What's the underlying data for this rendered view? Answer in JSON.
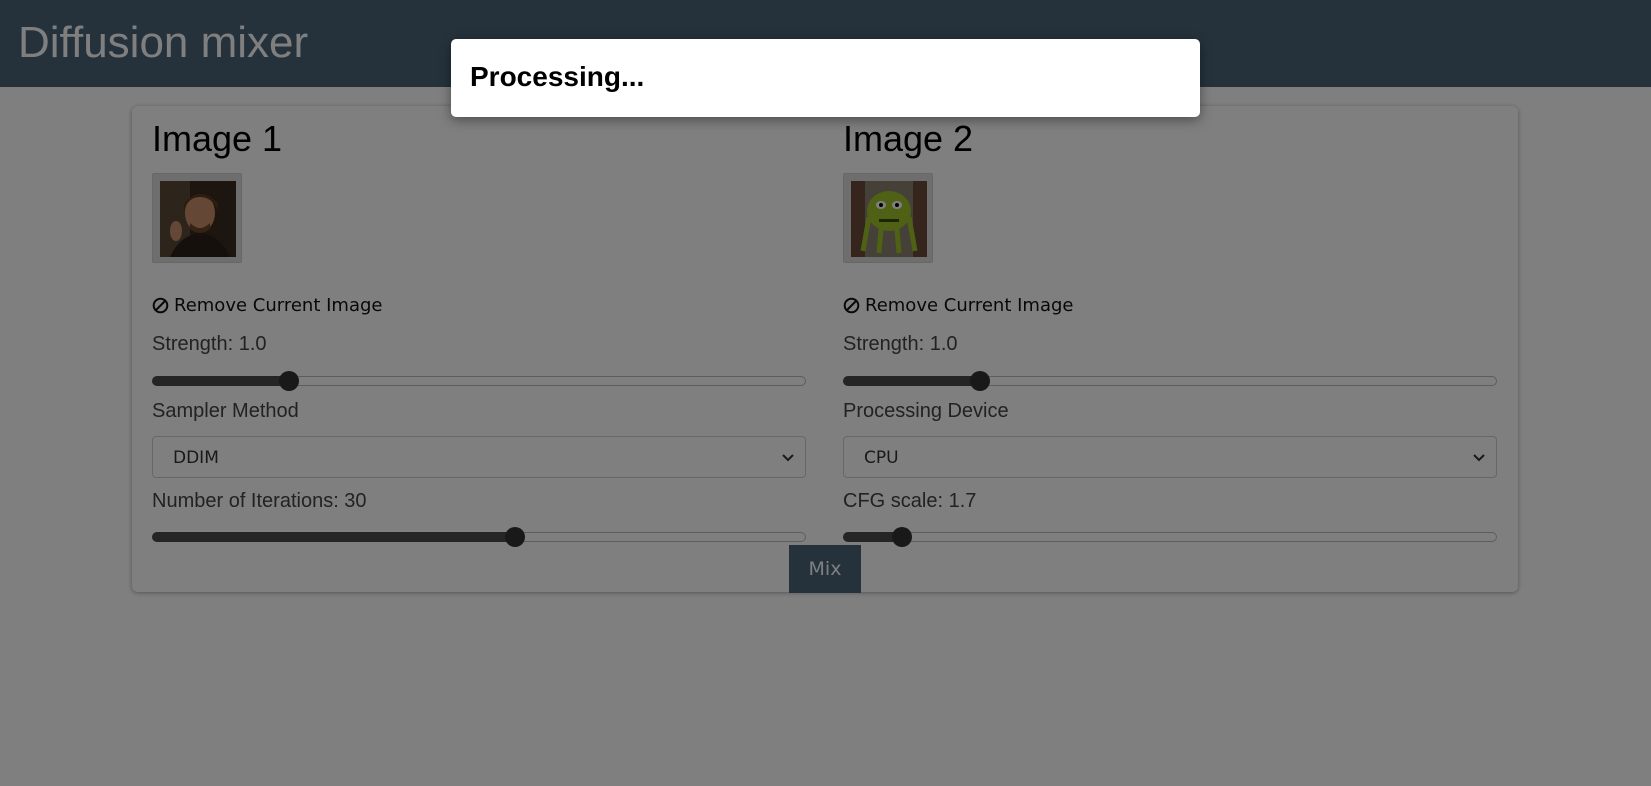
{
  "app": {
    "title": "Diffusion mixer"
  },
  "modal": {
    "text": "Processing..."
  },
  "image1": {
    "heading": "Image 1",
    "remove_label": "Remove Current Image",
    "strength_label": "Strength: 1.0",
    "strength_fraction": 0.21,
    "sampler_label": "Sampler Method",
    "sampler_value": "DDIM",
    "iterations_label": "Number of Iterations: 30",
    "iterations_fraction": 0.555
  },
  "image2": {
    "heading": "Image 2",
    "remove_label": "Remove Current Image",
    "strength_label": "Strength: 1.0",
    "strength_fraction": 0.21,
    "device_label": "Processing Device",
    "device_value": "CPU",
    "cfg_label": "CFG scale: 1.7",
    "cfg_fraction": 0.09
  },
  "mix_button": "Mix",
  "colors": {
    "header": "#4a6478",
    "button": "#4a6478"
  },
  "icons": [
    "ban-icon",
    "chevron-down-icon"
  ]
}
